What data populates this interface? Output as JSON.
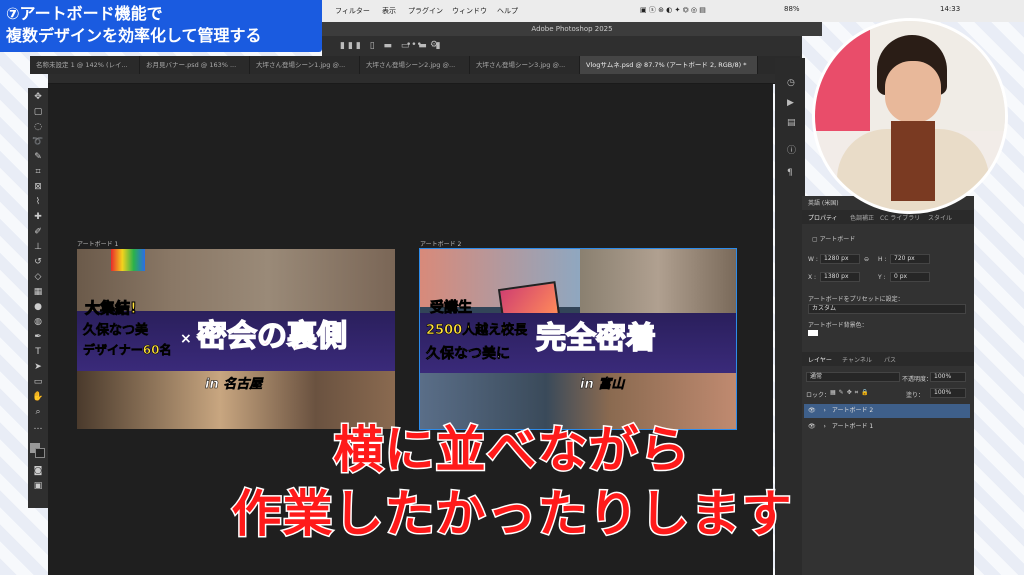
{
  "banner": {
    "line1": "⑦アートボード機能で",
    "line2": "複数デザインを効率化して管理する"
  },
  "menubar": {
    "items": [
      "フィルター",
      "表示",
      "プラグイン",
      "ウィンドウ",
      "ヘルプ"
    ],
    "battery": "88%",
    "time": "14:33"
  },
  "app": {
    "title": "Adobe Photoshop 2025"
  },
  "tabs": [
    "名称未設定 1 @ 142% (レイ...",
    "お月見バナー.psd @ 163% ...",
    "大坪さん登場シーン1.jpg @...",
    "大坪さん登場シーン2.jpg @...",
    "大坪さん登場シーン3.jpg @...",
    "大坪さん登場シーン3.jpg @...",
    "Vlogサムネ.psd @ 87.7% (アートボード 2, RGB/8) *"
  ],
  "canvas": {
    "artboard1": {
      "label": "アートボード 1",
      "lines": [
        "大集結!",
        "久保なつ美",
        "デザイナー60名",
        "×",
        "密会の裏側",
        "in 名古屋"
      ]
    },
    "artboard2": {
      "label": "アートボード 2",
      "lines": [
        "受講生",
        "2500人越え校長",
        "久保なつ美に",
        "完全密着",
        "in 富山"
      ]
    }
  },
  "properties": {
    "tabs": [
      "プロパティ",
      "色調補正",
      "CC ライブラリ",
      "スタイル"
    ],
    "section": "アートボード",
    "w": "1280 px",
    "h": "720 px",
    "x": "1380 px",
    "y": "0 px",
    "preset_label": "アートボードをプリセットに設定：",
    "preset_value": "カスタム",
    "bg_label": "アートボード背景色："
  },
  "layers": {
    "tabs": [
      "レイヤー",
      "チャンネル",
      "パス"
    ],
    "mode": "通常",
    "opacity_label": "不透明度：",
    "opacity": "100%",
    "lock_label": "ロック：",
    "fill_label": "塗り：",
    "fill": "100%",
    "items": [
      "アートボード 2",
      "アートボード 1"
    ]
  },
  "side": {
    "lang": "英語 (米国)"
  },
  "subtitle": {
    "line1": "横に並べながら",
    "line2": "作業したかったりします"
  },
  "colors": {
    "accent": "#1a5be0",
    "subtitle": "#ff1a1a",
    "selection": "#3e5f8a"
  }
}
